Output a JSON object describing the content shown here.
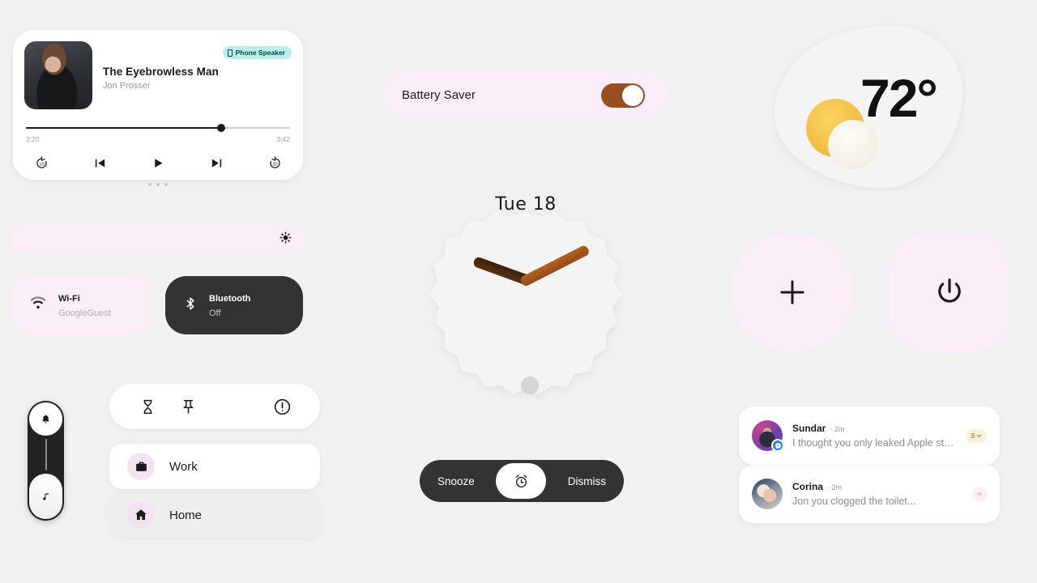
{
  "background_color": "#f1f1f1",
  "media_player": {
    "track_title": "The Eyebrowless Man",
    "artist": "Jon Prosser",
    "output_chip": "Phone Speaker",
    "output_icon": "phone-icon",
    "elapsed_time": "2:20",
    "total_time": "3:42",
    "progress_percent": 72,
    "controls": [
      {
        "name": "replay-10-button",
        "icon": "replay-10-icon"
      },
      {
        "name": "previous-track-button",
        "icon": "skip-previous-icon"
      },
      {
        "name": "play-button",
        "icon": "play-icon"
      },
      {
        "name": "next-track-button",
        "icon": "skip-next-icon"
      },
      {
        "name": "forward-30-button",
        "icon": "forward-30-icon"
      }
    ],
    "page_dots": 3
  },
  "brightness": {
    "icon": "brightness-icon"
  },
  "quick_tiles": [
    {
      "name": "wifi-tile",
      "icon": "wifi-icon",
      "label": "Wi-Fi",
      "sub": "GoogleGuest",
      "state": "on",
      "bg": "#fbeef8"
    },
    {
      "name": "bluetooth-tile",
      "icon": "bluetooth-icon",
      "label": "Bluetooth",
      "sub": "Off",
      "state": "off",
      "bg": "#333333"
    }
  ],
  "volume_slider": {
    "top_icon": "bell-icon",
    "thumb_icon": "music-note-icon",
    "track_color": "#232323"
  },
  "icon_row": [
    {
      "name": "hourglass-button",
      "icon": "hourglass-icon"
    },
    {
      "name": "pin-button",
      "icon": "pin-icon"
    },
    {
      "name": "alert-button",
      "icon": "alert-circle-icon"
    }
  ],
  "places": [
    {
      "name": "work-card",
      "label": "Work",
      "icon": "briefcase-icon",
      "bg": "#ffffff"
    },
    {
      "name": "home-card",
      "label": "Home",
      "icon": "home-icon",
      "bg": "#eeeeee"
    }
  ],
  "battery_saver": {
    "label": "Battery Saver",
    "toggle_state": "on",
    "toggle_color": "#9a4f22"
  },
  "clock": {
    "date_label": "Tue 18",
    "hour_hand_color": "#3a1f0b",
    "minute_hand_color": "#b4601f",
    "center_dot_color": "#d5d5d5"
  },
  "alarm_bar": {
    "snooze_label": "Snooze",
    "dismiss_label": "Dismiss",
    "center_icon": "alarm-clock-icon"
  },
  "weather": {
    "temperature": "72°",
    "icon": "sun-behind-cloud-icon",
    "sun_color": "#f0b93c",
    "cloud_color": "#f2f0e6"
  },
  "action_buttons": [
    {
      "name": "add-button",
      "icon": "plus-icon",
      "bg": "#fbeef8"
    },
    {
      "name": "power-button",
      "icon": "power-icon",
      "bg": "#fbeef8"
    }
  ],
  "notifications": [
    {
      "name": "notification-sundar",
      "sender": "Sundar",
      "time": "2m",
      "message": "I thought you only leaked Apple stuff...",
      "badge_count": "3",
      "app_badge": "messenger-icon",
      "has_count_badge": true
    },
    {
      "name": "notification-corina",
      "sender": "Corina",
      "time": "2m",
      "message": "Jon you clogged the toilet...",
      "badge_count": "",
      "app_badge": "",
      "has_count_badge": false
    }
  ]
}
